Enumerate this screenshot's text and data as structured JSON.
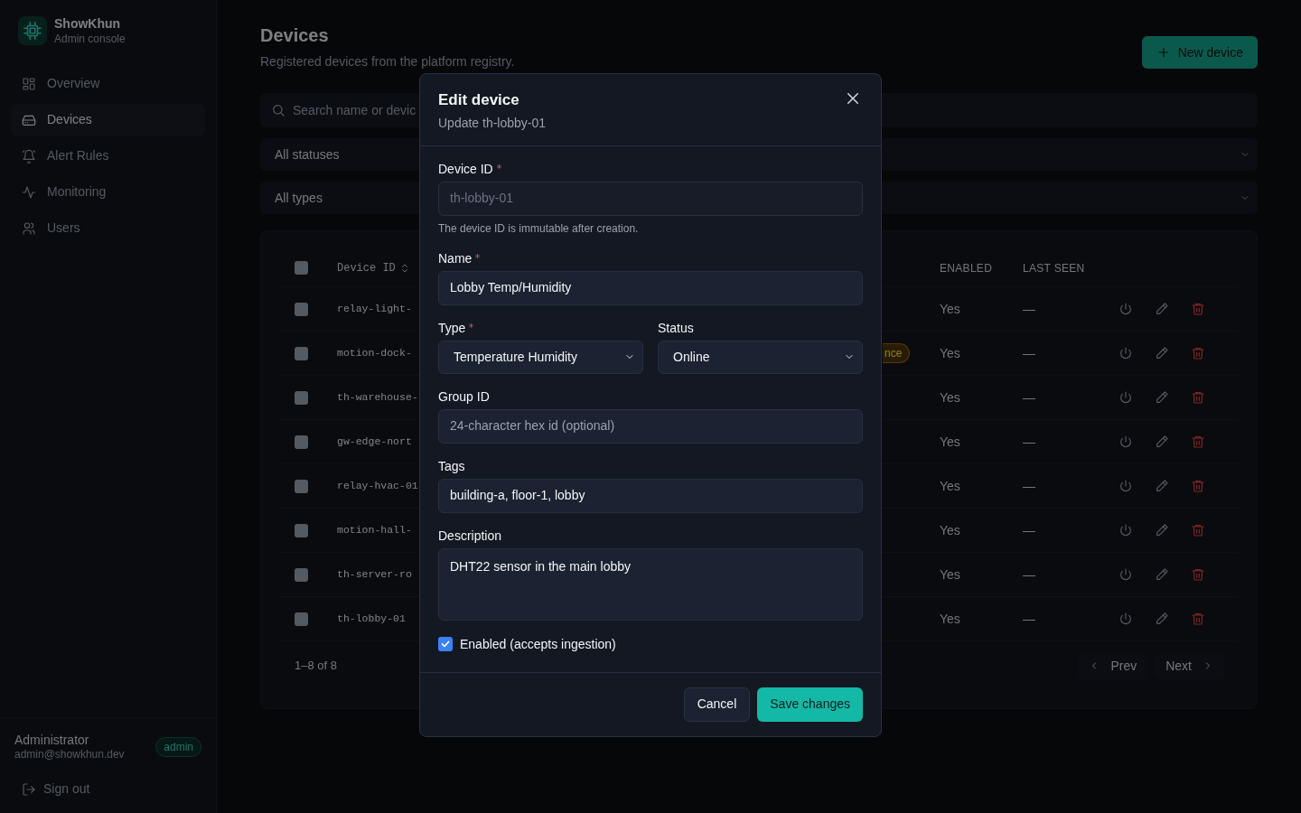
{
  "sidebar": {
    "brand": {
      "name": "ShowKhun",
      "subtitle": "Admin console"
    },
    "nav": [
      {
        "kind": "grid",
        "label": "Overview",
        "selected": false
      },
      {
        "kind": "drive",
        "label": "Devices",
        "selected": true
      },
      {
        "kind": "bell",
        "label": "Alert Rules",
        "selected": false
      },
      {
        "kind": "pulse",
        "label": "Monitoring",
        "selected": false
      },
      {
        "kind": "users",
        "label": "Users",
        "selected": false
      }
    ],
    "user": {
      "name": "Administrator",
      "email": "admin@showkhun.dev",
      "role": "admin"
    },
    "sign_out": "Sign out"
  },
  "page": {
    "title": "Devices",
    "subtitle": "Registered devices from the platform registry.",
    "new_button": "New device",
    "search": {
      "placeholder": "Search name or devic"
    },
    "filters": [
      "All statuses",
      "All types"
    ],
    "table": {
      "all_checked": false,
      "columns": [
        "Device ID",
        "ENABLED",
        "LAST SEEN"
      ],
      "rows": [
        {
          "device_id": "relay-light-",
          "checked": false,
          "enabled": "Yes",
          "last_seen": "—"
        },
        {
          "device_id": "motion-dock-",
          "checked": false,
          "status": "nce",
          "enabled": "Yes",
          "last_seen": "—"
        },
        {
          "device_id": "th-warehouse-",
          "checked": false,
          "enabled": "Yes",
          "last_seen": "—"
        },
        {
          "device_id": "gw-edge-nort",
          "checked": false,
          "enabled": "Yes",
          "last_seen": "—"
        },
        {
          "device_id": "relay-hvac-01",
          "checked": false,
          "enabled": "Yes",
          "last_seen": "—"
        },
        {
          "device_id": "motion-hall-",
          "checked": false,
          "enabled": "Yes",
          "last_seen": "—"
        },
        {
          "device_id": "th-server-ro",
          "checked": false,
          "enabled": "Yes",
          "last_seen": "—"
        },
        {
          "device_id": "th-lobby-01",
          "checked": false,
          "enabled": "Yes",
          "last_seen": "—"
        }
      ],
      "range": "1–8 of 8",
      "prev": "Prev",
      "next": "Next"
    }
  },
  "modal": {
    "title": "Edit device",
    "subtitle": "Update th-lobby-01",
    "fields": [
      {
        "kind": "input",
        "label": "Device ID",
        "required": true,
        "disabled": true,
        "value": "th-lobby-01",
        "hint": "The device ID is immutable after creation."
      },
      {
        "kind": "input",
        "label": "Name",
        "required": true,
        "disabled": false,
        "value": "Lobby Temp/Humidity"
      },
      {
        "kind": "select_pair",
        "items": [
          {
            "label": "Type",
            "required": true,
            "value": "Temperature Humidity"
          },
          {
            "label": "Status",
            "value": "Online"
          }
        ]
      },
      {
        "kind": "input",
        "label": "Group ID",
        "disabled": false,
        "placeholder": "24-character hex id (optional)"
      },
      {
        "kind": "input",
        "label": "Tags",
        "disabled": false,
        "value": "building-a, floor-1, lobby"
      },
      {
        "kind": "textarea",
        "label": "Description",
        "value": "DHT22 sensor in the main lobby"
      },
      {
        "kind": "checkbox",
        "label": "Enabled (accepts ingestion)",
        "checked": true
      }
    ],
    "cancel": "Cancel",
    "save": "Save changes"
  }
}
